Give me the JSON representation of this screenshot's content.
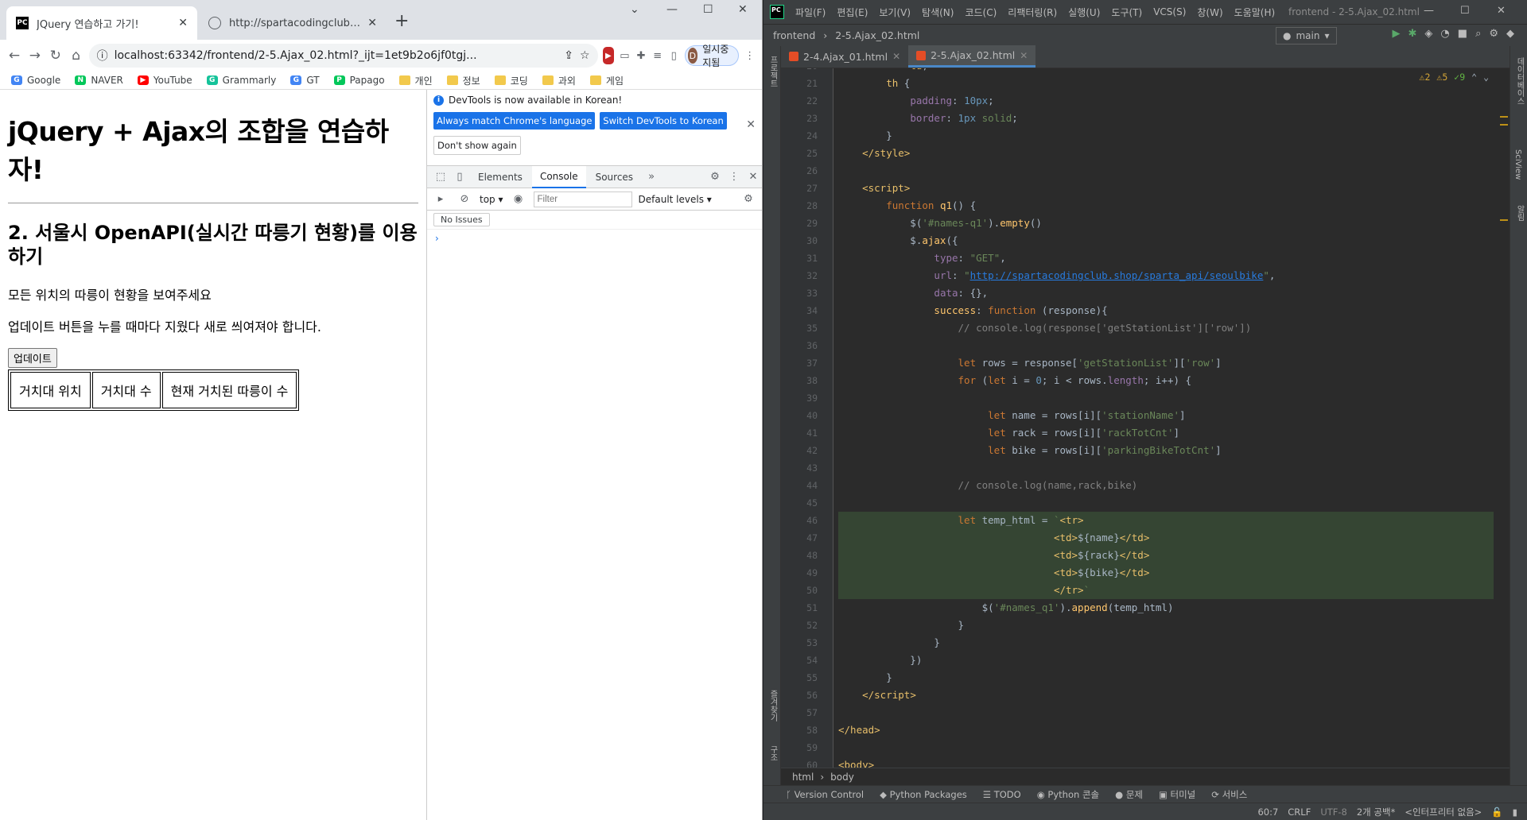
{
  "chrome": {
    "tabs": [
      {
        "title": "JQuery 연습하고 가기!",
        "active": true
      },
      {
        "title": "http://spartacodingclub.shop/sp",
        "active": false
      }
    ],
    "url": "localhost:63342/frontend/2-5.Ajax_02.html?_ijt=1et9b2o6jf0tgj...",
    "profile": {
      "initial": "D",
      "label": "일시중지됨"
    },
    "bookmarks": [
      {
        "label": "Google",
        "icon": "G",
        "color": "#4285f4",
        "folder": false
      },
      {
        "label": "NAVER",
        "icon": "N",
        "color": "#03c75a",
        "folder": false
      },
      {
        "label": "YouTube",
        "icon": "▶",
        "color": "#ff0000",
        "folder": false
      },
      {
        "label": "Grammarly",
        "icon": "G",
        "color": "#15c39a",
        "folder": false
      },
      {
        "label": "GT",
        "icon": "G",
        "color": "#4285f4",
        "folder": false
      },
      {
        "label": "Papago",
        "icon": "P",
        "color": "#03c75a",
        "folder": false
      },
      {
        "label": "개인",
        "folder": true
      },
      {
        "label": "정보",
        "folder": true
      },
      {
        "label": "코딩",
        "folder": true
      },
      {
        "label": "과외",
        "folder": true
      },
      {
        "label": "게임",
        "folder": true
      }
    ]
  },
  "page": {
    "h1": "jQuery + Ajax의 조합을 연습하자!",
    "h2": "2. 서울시 OpenAPI(실시간 따릉기 현황)를 이용하기",
    "p1": "모든 위치의 따릉이 현황을 보여주세요",
    "p2": "업데이트 버튼을 누를 때마다 지웠다 새로 씌여져야 합니다.",
    "button": "업데이트",
    "headers": [
      "거치대 위치",
      "거치대 수",
      "현재 거치된 따릉이 수"
    ]
  },
  "devtools": {
    "banner_msg": "DevTools is now available in Korean!",
    "btn_match": "Always match Chrome's language",
    "btn_switch": "Switch DevTools to Korean",
    "btn_dont": "Don't show again",
    "tabs": [
      "Elements",
      "Console",
      "Sources"
    ],
    "context": "top",
    "filter_placeholder": "Filter",
    "levels": "Default levels",
    "issues": "No Issues"
  },
  "ide": {
    "menu": [
      "파일(F)",
      "편집(E)",
      "보기(V)",
      "탐색(N)",
      "코드(C)",
      "리팩터링(R)",
      "실행(U)",
      "도구(T)",
      "VCS(S)",
      "창(W)",
      "도움말(H)"
    ],
    "window_title": "frontend - 2-5.Ajax_02.html",
    "nav_project": "frontend",
    "nav_file": "2-5.Ajax_02.html",
    "run_config": "main",
    "editor_tabs": [
      {
        "label": "2-4.Ajax_01.html",
        "active": false
      },
      {
        "label": "2-5.Ajax_02.html",
        "active": true
      }
    ],
    "inspections": {
      "warn1": "2",
      "warn2": "5",
      "ok": "9"
    },
    "breadcrumb": [
      "html",
      "body"
    ],
    "bottom_tools": [
      "Version Control",
      "Python Packages",
      "TODO",
      "Python 콘솔",
      "문제",
      "터미널",
      "서비스"
    ],
    "status": [
      "60:7",
      "CRLF",
      "UTF-8",
      "2개 공백*",
      "<인터프리터 없음>"
    ],
    "left_strip": [
      "프로젝트",
      "구조",
      "즐겨찾기"
    ],
    "right_strip": [
      "데이터베이스",
      "SciView",
      "알림"
    ]
  }
}
